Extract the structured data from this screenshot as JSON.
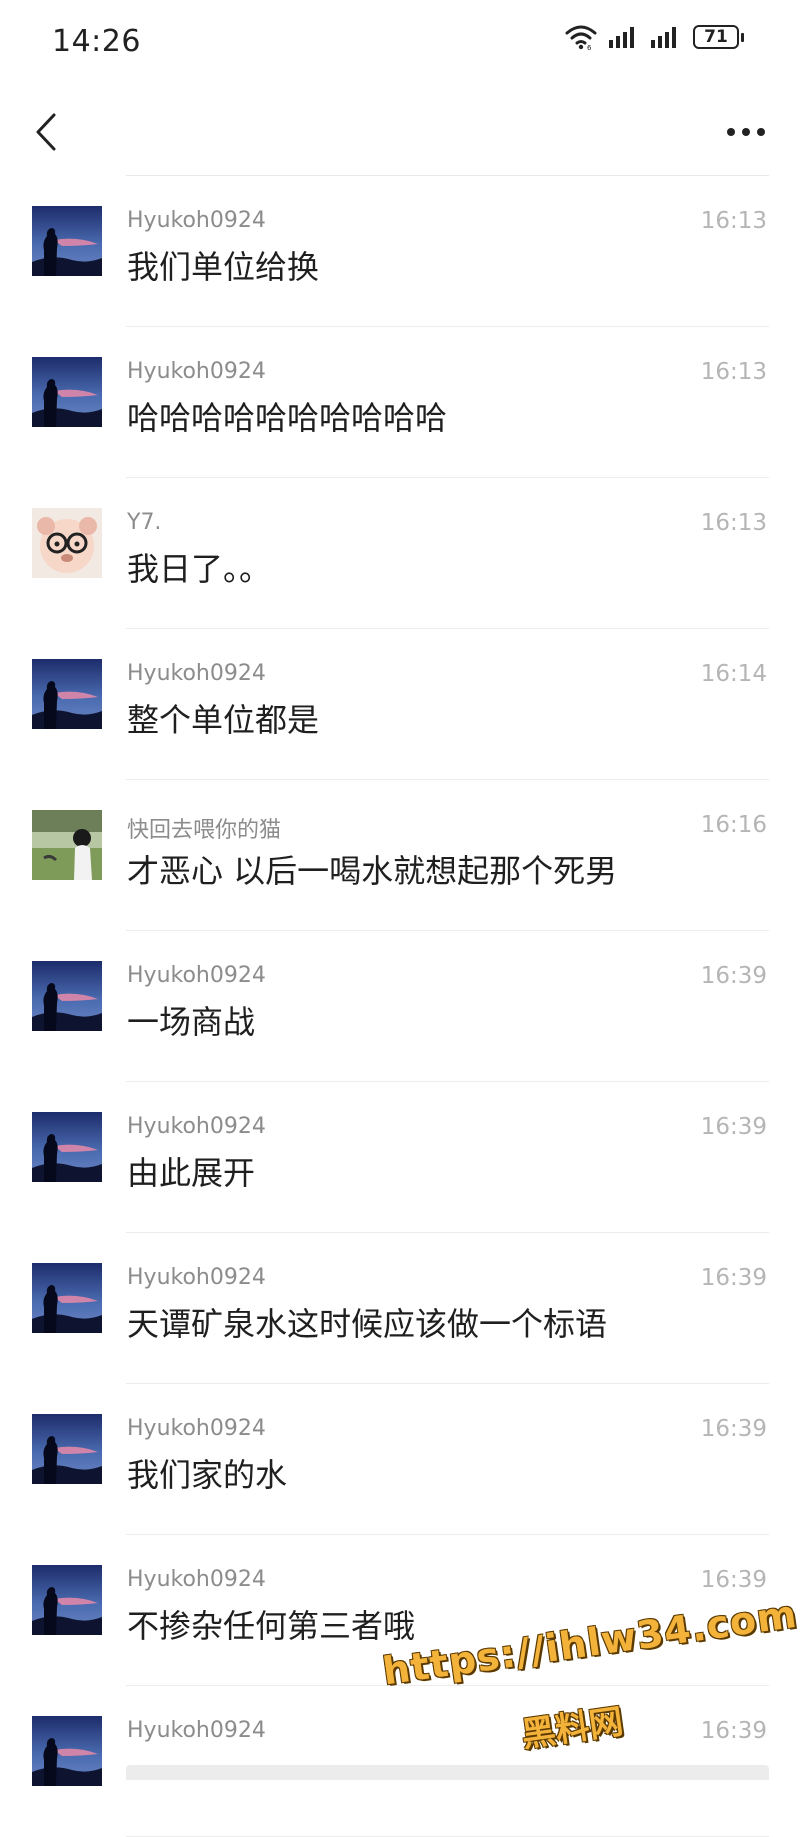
{
  "status_bar": {
    "time": "14:26",
    "battery_level": "71"
  },
  "nav": {
    "back_icon": "chevron-left-icon",
    "more_icon": "more-horizontal-icon"
  },
  "messages": [
    {
      "sender": "Hyukoh0924",
      "time": "16:13",
      "text": "我们单位给换",
      "avatar": "night-sky-avatar"
    },
    {
      "sender": "Hyukoh0924",
      "time": "16:13",
      "text": "哈哈哈哈哈哈哈哈哈哈",
      "avatar": "night-sky-avatar"
    },
    {
      "sender": "Y7.",
      "time": "16:13",
      "text": "我日了。。",
      "avatar": "plush-bear-glasses-avatar"
    },
    {
      "sender": "Hyukoh0924",
      "time": "16:14",
      "text": "整个单位都是",
      "avatar": "night-sky-avatar"
    },
    {
      "sender": "快回去喂你的猫",
      "time": "16:16",
      "text": "才恶心 以后一喝水就想起那个死男",
      "avatar": "girl-on-grass-avatar"
    },
    {
      "sender": "Hyukoh0924",
      "time": "16:39",
      "text": "一场商战",
      "avatar": "night-sky-avatar"
    },
    {
      "sender": "Hyukoh0924",
      "time": "16:39",
      "text": "由此展开",
      "avatar": "night-sky-avatar"
    },
    {
      "sender": "Hyukoh0924",
      "time": "16:39",
      "text": "天谭矿泉水这时候应该做一个标语",
      "avatar": "night-sky-avatar"
    },
    {
      "sender": "Hyukoh0924",
      "time": "16:39",
      "text": "我们家的水",
      "avatar": "night-sky-avatar"
    },
    {
      "sender": "Hyukoh0924",
      "time": "16:39",
      "text": "不掺杂任何第三者哦",
      "avatar": "night-sky-avatar"
    },
    {
      "sender": "Hyukoh0924",
      "time": "16:39",
      "text": "",
      "avatar": "night-sky-avatar"
    }
  ],
  "watermark": {
    "url": "https://ihlw34.com",
    "name": "黑料网"
  },
  "colors": {
    "background": "#ffffff",
    "sender": "#8c8c8c",
    "time": "#b5b5b5",
    "divider": "#ececec",
    "watermark": "#f3b23a"
  }
}
